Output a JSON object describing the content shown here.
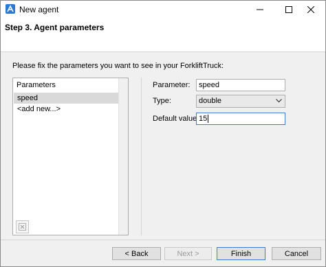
{
  "window": {
    "title": "New agent"
  },
  "header": {
    "step_title": "Step 3. Agent parameters"
  },
  "instruction": "Please fix the parameters you want to see in your ForkliftTruck:",
  "parameters_list": {
    "header": "Parameters",
    "items": [
      {
        "label": "speed",
        "selected": true
      },
      {
        "label": "<add new...>",
        "selected": false
      }
    ]
  },
  "form": {
    "parameter_label": "Parameter:",
    "parameter_value": "speed",
    "type_label": "Type:",
    "type_value": "double",
    "default_label": "Default value:",
    "default_value": "15"
  },
  "buttons": {
    "back": "< Back",
    "next": "Next >",
    "finish": "Finish",
    "cancel": "Cancel"
  },
  "colors": {
    "accent": "#3a7bd5",
    "app_icon": "#2a7ad5",
    "selection": "#d9d9d9"
  }
}
